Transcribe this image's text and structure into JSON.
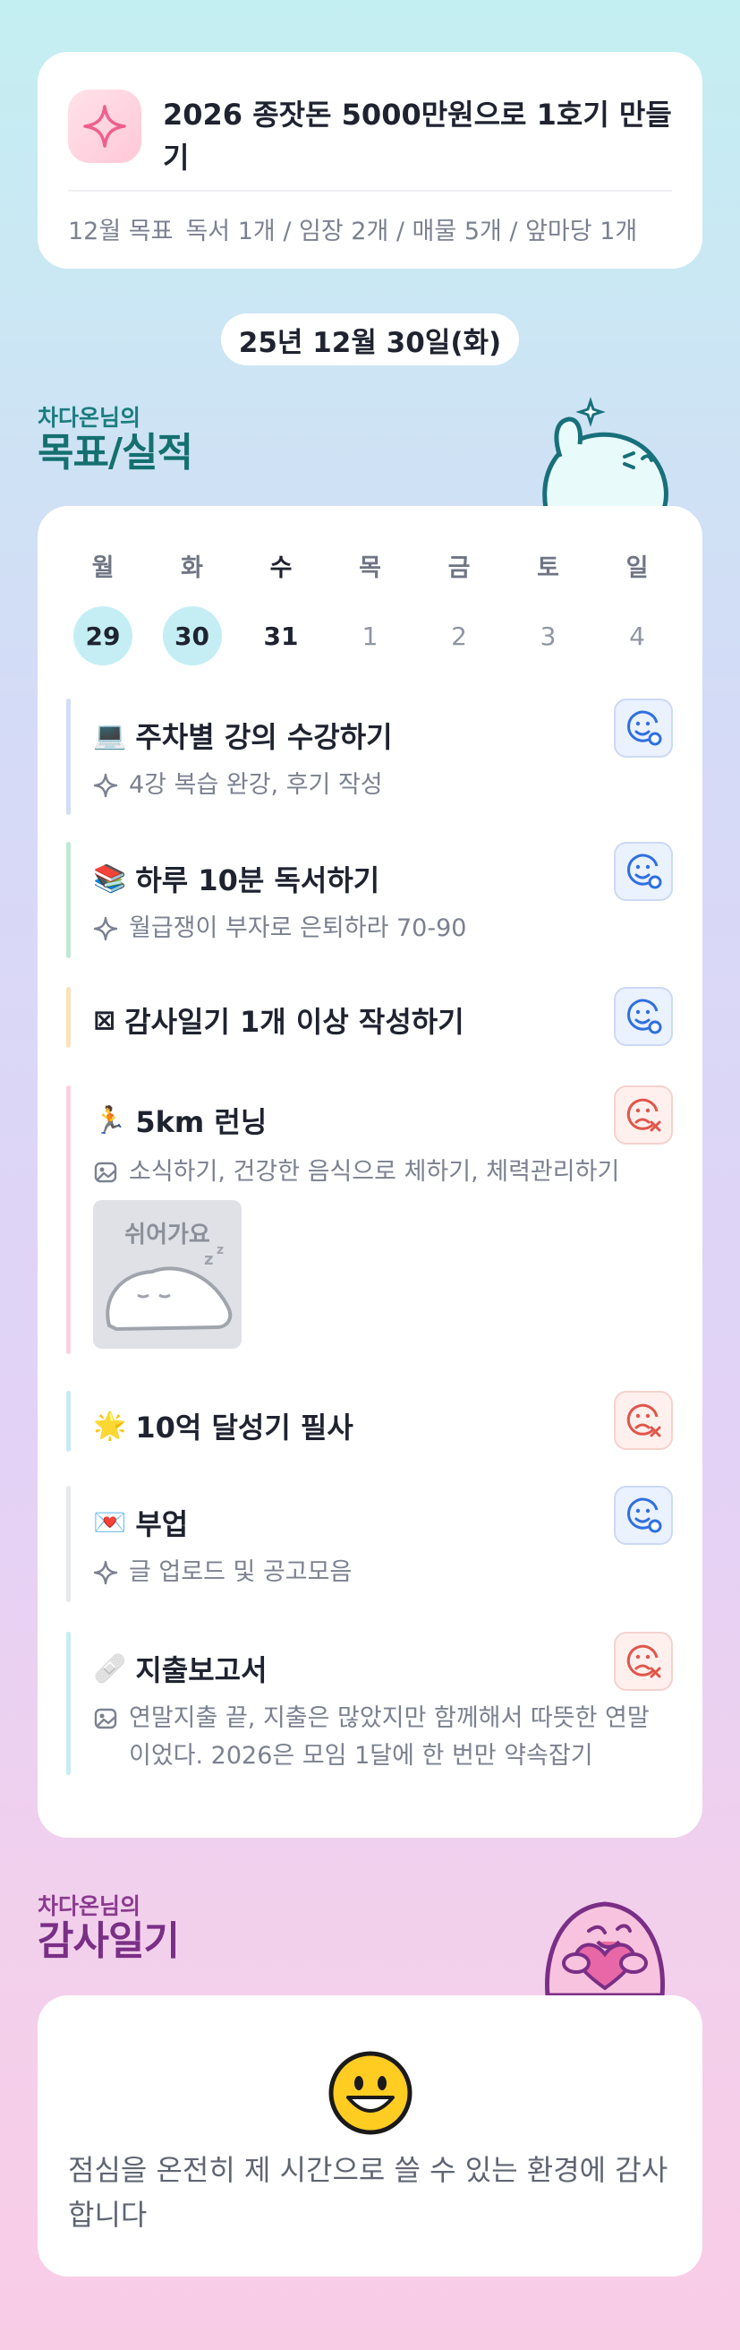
{
  "goal": {
    "title": "2026 종잣돈 5000만원으로 1호기 만들기",
    "month_label": "12월 목표",
    "targets": "독서 1개 / 임장 2개 / 매물 5개 / 앞마당 1개"
  },
  "date_label": "25년 12월 30일(화)",
  "goal_section": {
    "small": "차다온님의",
    "big": "목표/실적"
  },
  "week": [
    {
      "dow": "월",
      "num": "29",
      "state": "done"
    },
    {
      "dow": "화",
      "num": "30",
      "state": "done"
    },
    {
      "dow": "수",
      "num": "31",
      "state": "today"
    },
    {
      "dow": "목",
      "num": "1",
      "state": "future"
    },
    {
      "dow": "금",
      "num": "2",
      "state": "future"
    },
    {
      "dow": "토",
      "num": "3",
      "state": "future"
    },
    {
      "dow": "일",
      "num": "4",
      "state": "future"
    }
  ],
  "tasks": [
    {
      "emoji": "💻",
      "title": "주차별 강의 수강하기",
      "note": "4강 복습 완강, 후기 작성",
      "note_icon": "sparkle-icon",
      "status": "done",
      "bar_color": "#d4ddf6"
    },
    {
      "emoji": "📚",
      "title": "하루 10분 독서하기",
      "note": "월급쟁이 부자로 은퇴하라 70-90",
      "note_icon": "sparkle-icon",
      "status": "done",
      "bar_color": "#bfe9d6"
    },
    {
      "emoji": "⊠",
      "title": "감사일기 1개 이상 작성하기",
      "note": "",
      "status": "done",
      "bar_color": "#fbe2b8"
    },
    {
      "emoji": "🏃",
      "title": "5km 런닝",
      "note": "소식하기, 건강한 음식으로 체하기, 체력관리하기",
      "note_icon": "photo-icon",
      "status": "missed",
      "bar_color": "#fad0e4",
      "image_label": "쉬어가요"
    },
    {
      "emoji": "🌟",
      "title": "10억 달성기 필사",
      "note": "",
      "status": "missed",
      "bar_color": "#c8eaf6"
    },
    {
      "emoji": "💌",
      "title": "부업",
      "note": "글 업로드 및 공고모음",
      "note_icon": "sparkle-icon",
      "status": "done",
      "bar_color": "#e8e9ec"
    },
    {
      "emoji": "🩹",
      "title": "지출보고서",
      "note": "연말지출 끝, 지출은 많았지만 함께해서 따뜻한 연말이었다. 2026은 모임 1달에 한 번만 약속잡기",
      "note_icon": "photo-icon",
      "status": "missed",
      "bar_color": "#c5ecf4"
    }
  ],
  "thanks_section": {
    "small": "차다온님의",
    "big": "감사일기"
  },
  "thanks": {
    "text": "점심을 온전히 제 시간으로 쓸 수 있는 환경에 감사합니다"
  },
  "colors": {
    "teal": "#1a7d7f",
    "purple": "#7a2f86",
    "ok_blue": "#2f6fe0",
    "miss_red": "#e0564a",
    "pink": "#f08fb2"
  }
}
